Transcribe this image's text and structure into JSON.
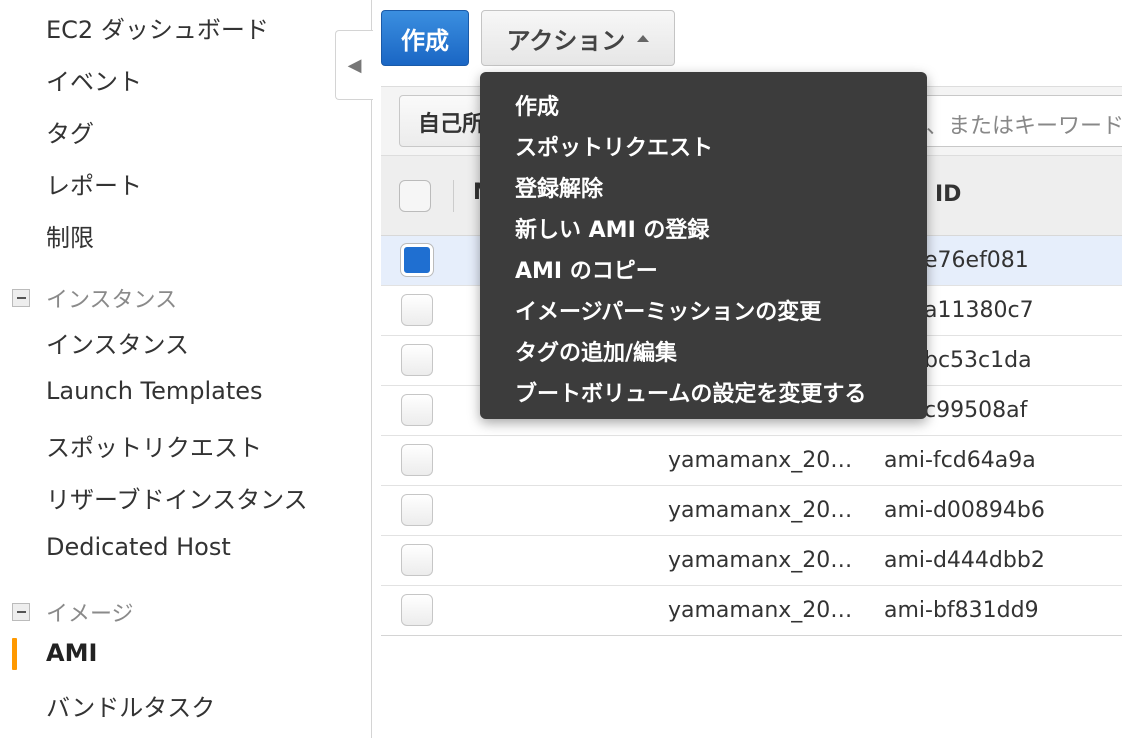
{
  "sidebar": {
    "items_top": [
      {
        "label": "EC2 ダッシュボード"
      },
      {
        "label": "イベント"
      },
      {
        "label": "タグ"
      },
      {
        "label": "レポート"
      },
      {
        "label": "制限"
      }
    ],
    "group_instances": {
      "label": "インスタンス",
      "items": [
        {
          "label": "インスタンス"
        },
        {
          "label": "Launch Templates"
        },
        {
          "label": "スポットリクエスト"
        },
        {
          "label": "リザーブドインスタンス"
        },
        {
          "label": "Dedicated Host"
        }
      ]
    },
    "group_images": {
      "label": "イメージ",
      "items": [
        {
          "label": "AMI",
          "active": true
        },
        {
          "label": "バンドルタスク"
        }
      ]
    },
    "accent_color": "#ff9900"
  },
  "toolbar": {
    "create_label": "作成",
    "action_label": "アクション"
  },
  "filter": {
    "dropdown_label": "自己所",
    "search_placeholder": "、またはキーワード"
  },
  "table": {
    "header_name": "N",
    "header_id": "ID",
    "rows": [
      {
        "name": "",
        "id": "e76ef081",
        "checked": true
      },
      {
        "name": "",
        "id": "a11380c7",
        "checked": false
      },
      {
        "name": "",
        "id": "bc53c1da",
        "checked": false
      },
      {
        "name": "",
        "id": "c99508af",
        "checked": false
      },
      {
        "name": "yamamanx_20…",
        "id": "ami-fcd64a9a",
        "checked": false
      },
      {
        "name": "yamamanx_20…",
        "id": "ami-d00894b6",
        "checked": false
      },
      {
        "name": "yamamanx_20…",
        "id": "ami-d444dbb2",
        "checked": false
      },
      {
        "name": "yamamanx_20…",
        "id": "ami-bf831dd9",
        "checked": false
      }
    ]
  },
  "action_menu": {
    "items": [
      {
        "label": "作成"
      },
      {
        "label": "スポットリクエスト"
      },
      {
        "label": "登録解除"
      },
      {
        "label": "新しい AMI の登録"
      },
      {
        "label": "AMI のコピー"
      },
      {
        "label": "イメージパーミッションの変更"
      },
      {
        "label": "タグの追加/編集"
      },
      {
        "label": "ブートボリュームの設定を変更する"
      }
    ]
  },
  "colors": {
    "primary_button": "#1a66c4",
    "menu_background": "#3c3c3c",
    "selected_row": "#e6eefb"
  }
}
